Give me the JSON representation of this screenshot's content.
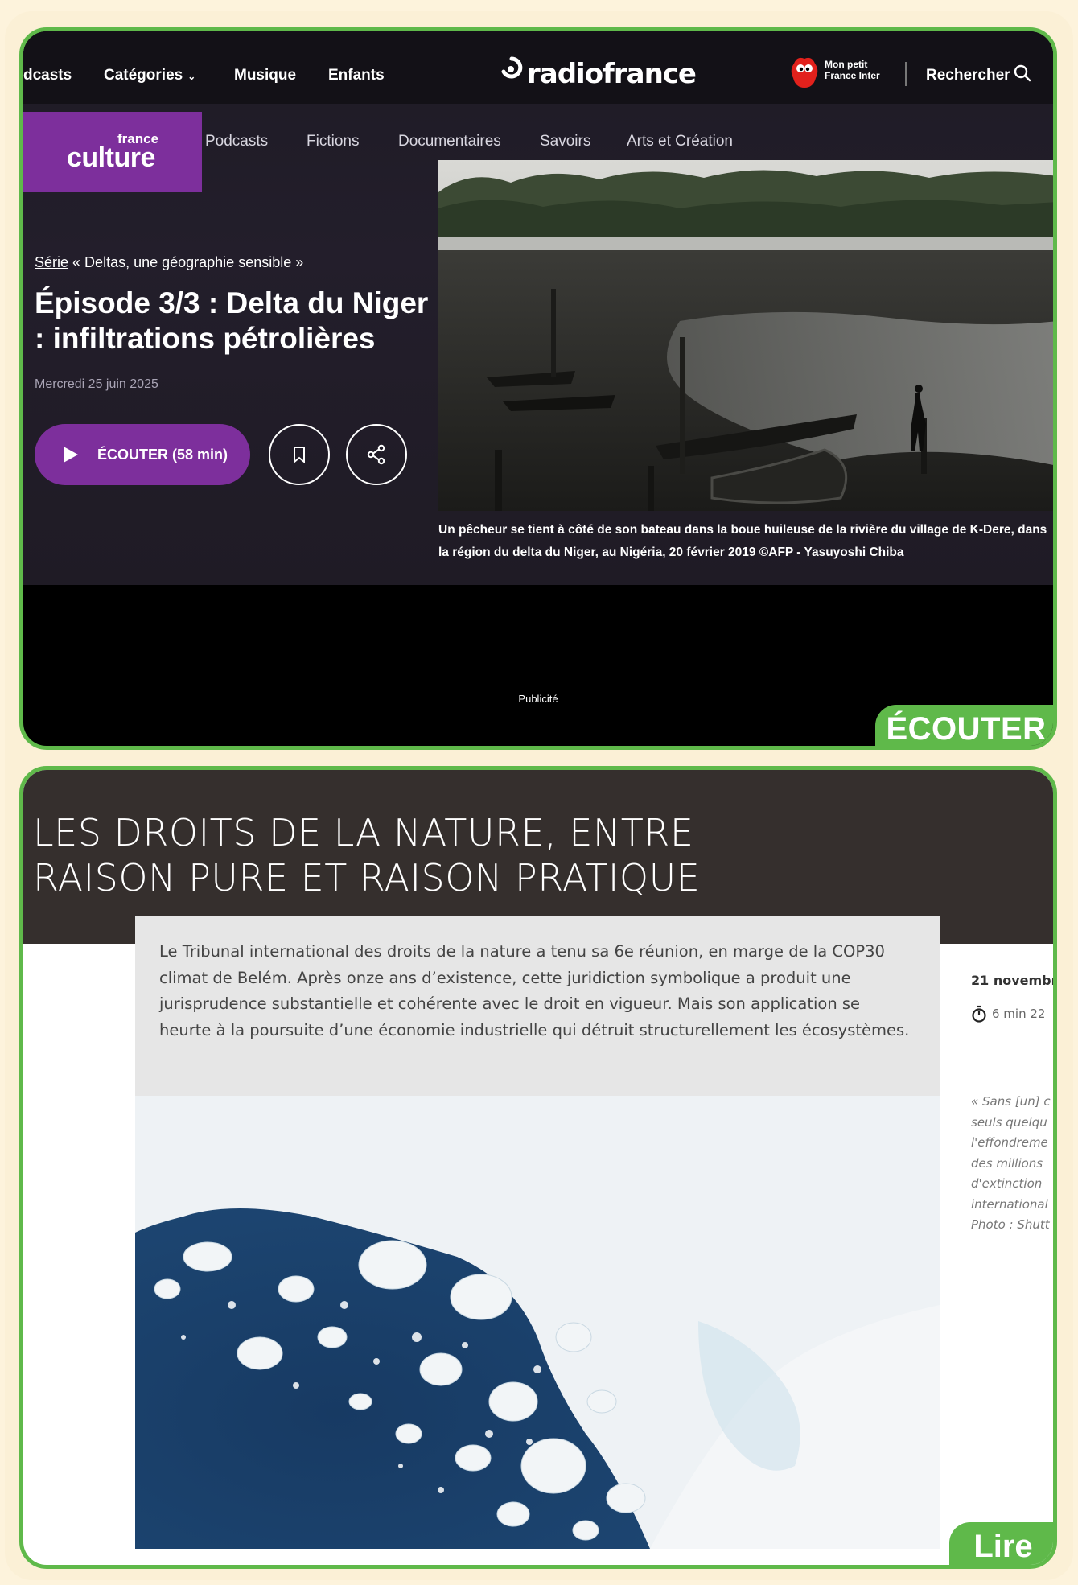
{
  "card1": {
    "topnav": {
      "items": [
        "dcasts",
        "Catégories",
        "Musique",
        "Enfants"
      ],
      "brand": "radiofrance",
      "mon_petit": "Mon petit France Inter",
      "search_label": "Rechercher"
    },
    "station_logo": {
      "small": "france",
      "big": "culture"
    },
    "subnav": [
      "Podcasts",
      "Fictions",
      "Documentaires",
      "Savoirs",
      "Arts et Création"
    ],
    "series_link": "Série",
    "series_name": "« Deltas, une géographie sensible »",
    "episode_title": "Épisode 3/3 : Delta du Niger : infiltrations pétrolières",
    "date": "Mercredi 25 juin 2025",
    "listen_button": "ÉCOUTER (58 min)",
    "caption": "Un pêcheur se tient à côté de son bateau dans la boue huileuse de la rivière du village de K-Dere, dans la région du delta du Niger, au Nigéria, 20 février 2019 ©AFP - Yasuyoshi Chiba",
    "ad_label": "Publicité",
    "tab_label": "ÉCOUTER"
  },
  "card2": {
    "title": "LES DROITS DE LA NATURE, ENTRE RAISON PURE ET RAISON PRATIQUE",
    "intro": "Le Tribunal international des droits de la nature a tenu sa 6e réunion, en marge de la COP30 climat de Belém. Après onze ans d’existence, cette juridiction symbolique a produit une jurisprudence substantielle et cohérente avec le droit en vigueur. Mais son application se heurte à la poursuite d’une économie industrielle qui détruit structurellement les écosystèmes.",
    "date": "21 novembr",
    "read_time": "6 min 22",
    "side_quote": [
      "« Sans [un] c",
      "seuls quelqu",
      "l'effondreme",
      "des millions",
      "d'extinction",
      "international",
      "Photo : Shutt"
    ],
    "tab_label": "Lire"
  },
  "colors": {
    "frame_green": "#5fb94a",
    "culture_purple": "#7d2f9c",
    "header_brown": "#352f2d",
    "background_cream": "#fdf3dc"
  }
}
